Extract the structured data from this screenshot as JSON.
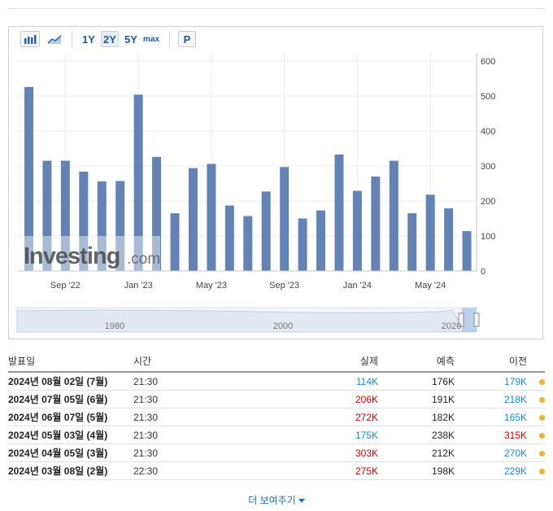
{
  "toolbar": {
    "range_buttons": [
      "1Y",
      "2Y",
      "5Y",
      "max"
    ],
    "active_range": "2Y",
    "p_label": "P",
    "icons": [
      "bar-chart-icon",
      "area-chart-icon"
    ]
  },
  "chart_data": {
    "type": "bar",
    "categories": [
      "Jul '22",
      "Aug '22",
      "Sep '22",
      "Oct '22",
      "Nov '22",
      "Dec '22",
      "Jan '23",
      "Feb '23",
      "Mar '23",
      "Apr '23",
      "May '23",
      "Jun '23",
      "Jul '23",
      "Aug '23",
      "Sep '23",
      "Oct '23",
      "Nov '23",
      "Dec '23",
      "Jan '24",
      "Feb '24",
      "Mar '24",
      "Apr '24",
      "May '24",
      "Jun '24",
      "Jul '24"
    ],
    "values": [
      526,
      315,
      315,
      284,
      256,
      257,
      504,
      326,
      165,
      294,
      306,
      187,
      157,
      227,
      297,
      150,
      173,
      333,
      229,
      270,
      315,
      165,
      218,
      179,
      114
    ],
    "x_tick_labels": [
      "Sep '22",
      "Jan '23",
      "May '23",
      "Sep '23",
      "Jan '24",
      "May '24"
    ],
    "y_ticks": [
      0,
      100,
      200,
      300,
      400,
      500,
      600
    ],
    "ylim": [
      0,
      600
    ],
    "bar_color": "#6283b3",
    "grid": true,
    "watermark": "Investing.com",
    "navigator_labels": [
      "1980",
      "2000",
      "2020"
    ]
  },
  "table": {
    "headers": {
      "date": "발표일",
      "time": "시간",
      "actual": "실제",
      "forecast": "예측",
      "previous": "이전"
    },
    "rows": [
      {
        "date": "2024년 08월 02일 (7월)",
        "time": "21:30",
        "actual": "114K",
        "actual_color": "blue",
        "forecast": "176K",
        "previous": "179K",
        "previous_color": "blue"
      },
      {
        "date": "2024년 07월 05일 (6월)",
        "time": "21:30",
        "actual": "206K",
        "actual_color": "red",
        "forecast": "191K",
        "previous": "218K",
        "previous_color": "blue"
      },
      {
        "date": "2024년 06월 07일 (5월)",
        "time": "21:30",
        "actual": "272K",
        "actual_color": "red",
        "forecast": "182K",
        "previous": "165K",
        "previous_color": "blue"
      },
      {
        "date": "2024년 05월 03일 (4월)",
        "time": "21:30",
        "actual": "175K",
        "actual_color": "blue",
        "forecast": "238K",
        "previous": "315K",
        "previous_color": "red"
      },
      {
        "date": "2024년 04월 05일 (3월)",
        "time": "21:30",
        "actual": "303K",
        "actual_color": "red",
        "forecast": "212K",
        "previous": "270K",
        "previous_color": "blue"
      },
      {
        "date": "2024년 03월 08일 (2월)",
        "time": "22:30",
        "actual": "275K",
        "actual_color": "red",
        "forecast": "198K",
        "previous": "229K",
        "previous_color": "blue"
      }
    ]
  },
  "show_more": "더 보여주기"
}
